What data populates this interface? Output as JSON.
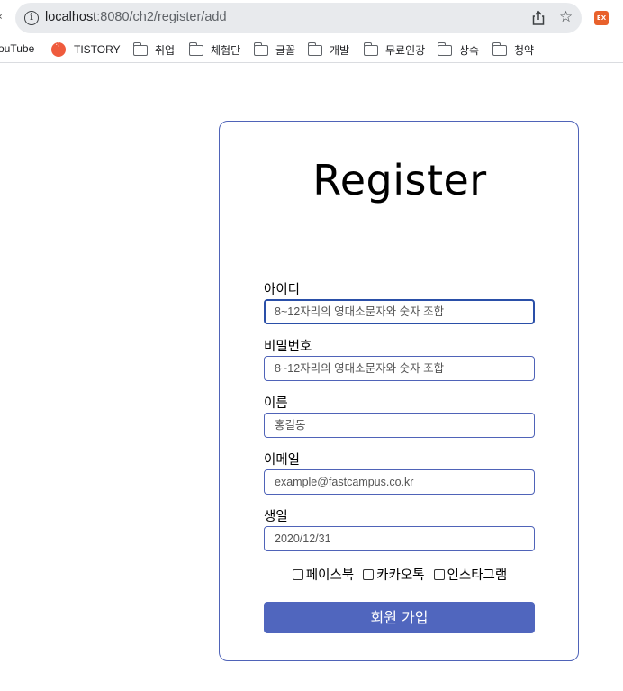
{
  "browser": {
    "url_host": "localhost",
    "url_path": ":8080/ch2/register/add",
    "bookmarks": [
      {
        "label": "ouTube",
        "icon": "youtube-icon"
      },
      {
        "label": "TISTORY",
        "icon": "tistory-icon"
      },
      {
        "label": "취업",
        "icon": "folder-icon"
      },
      {
        "label": "체험단",
        "icon": "folder-icon"
      },
      {
        "label": "글꼴",
        "icon": "folder-icon"
      },
      {
        "label": "개발",
        "icon": "folder-icon"
      },
      {
        "label": "무료인강",
        "icon": "folder-icon"
      },
      {
        "label": "상속",
        "icon": "folder-icon"
      },
      {
        "label": "청약",
        "icon": "folder-icon"
      }
    ],
    "extension_badge": "EX"
  },
  "form": {
    "title": "Register",
    "fields": [
      {
        "label": "아이디",
        "placeholder": "8~12자리의 영대소문자와 숫자 조합",
        "focused": true
      },
      {
        "label": "비밀번호",
        "placeholder": "8~12자리의 영대소문자와 숫자 조합"
      },
      {
        "label": "이름",
        "placeholder": "홍길동"
      },
      {
        "label": "이메일",
        "placeholder": "example@fastcampus.co.kr"
      },
      {
        "label": "생일",
        "placeholder": "2020/12/31"
      }
    ],
    "checkboxes": [
      {
        "label": "페이스북",
        "checked": false
      },
      {
        "label": "카카오톡",
        "checked": false
      },
      {
        "label": "인스타그램",
        "checked": false
      }
    ],
    "submit_label": "회원 가입"
  },
  "colors": {
    "accent": "#5066be",
    "border": "#4f63b8"
  }
}
